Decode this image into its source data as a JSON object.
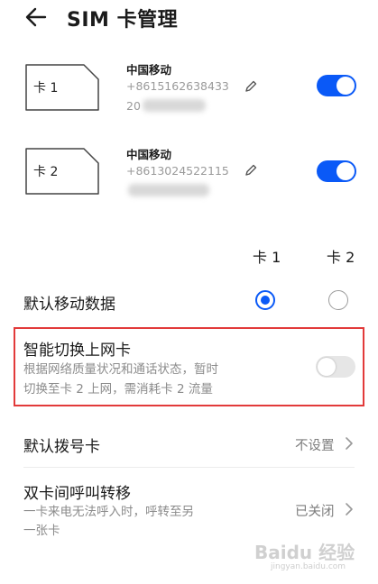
{
  "header": {
    "title": "SIM 卡管理"
  },
  "sims": [
    {
      "slot_label": "卡 1",
      "carrier": "中国移动",
      "number_line1": "+8615162638433",
      "number_line2": "20",
      "enabled": true
    },
    {
      "slot_label": "卡 2",
      "carrier": "中国移动",
      "number_line1": "+8613024522115",
      "number_line2": "",
      "enabled": true
    }
  ],
  "columns": {
    "card1": "卡 1",
    "card2": "卡 2"
  },
  "default_data": {
    "title": "默认移动数据",
    "selected": "card1"
  },
  "smart_switch": {
    "title": "智能切换上网卡",
    "desc_line1": "根据网络质量状况和通话状态，暂时",
    "desc_line2": "切换至卡 2 上网，需消耗卡 2 流量",
    "enabled": false
  },
  "default_dial": {
    "title": "默认拨号卡",
    "value": "不设置"
  },
  "call_forward": {
    "title": "双卡间呼叫转移",
    "desc_line1": "一卡来电无法呼入时，呼转至另",
    "desc_line2": "一张卡",
    "value": "已关闭"
  },
  "watermark": {
    "line1": "Baidu 经验",
    "line2": "jingyan.baidu.com"
  },
  "colors": {
    "accent": "#0a59f7",
    "highlight_border": "#e23a3a",
    "secondary_text": "#8c8c8c"
  }
}
